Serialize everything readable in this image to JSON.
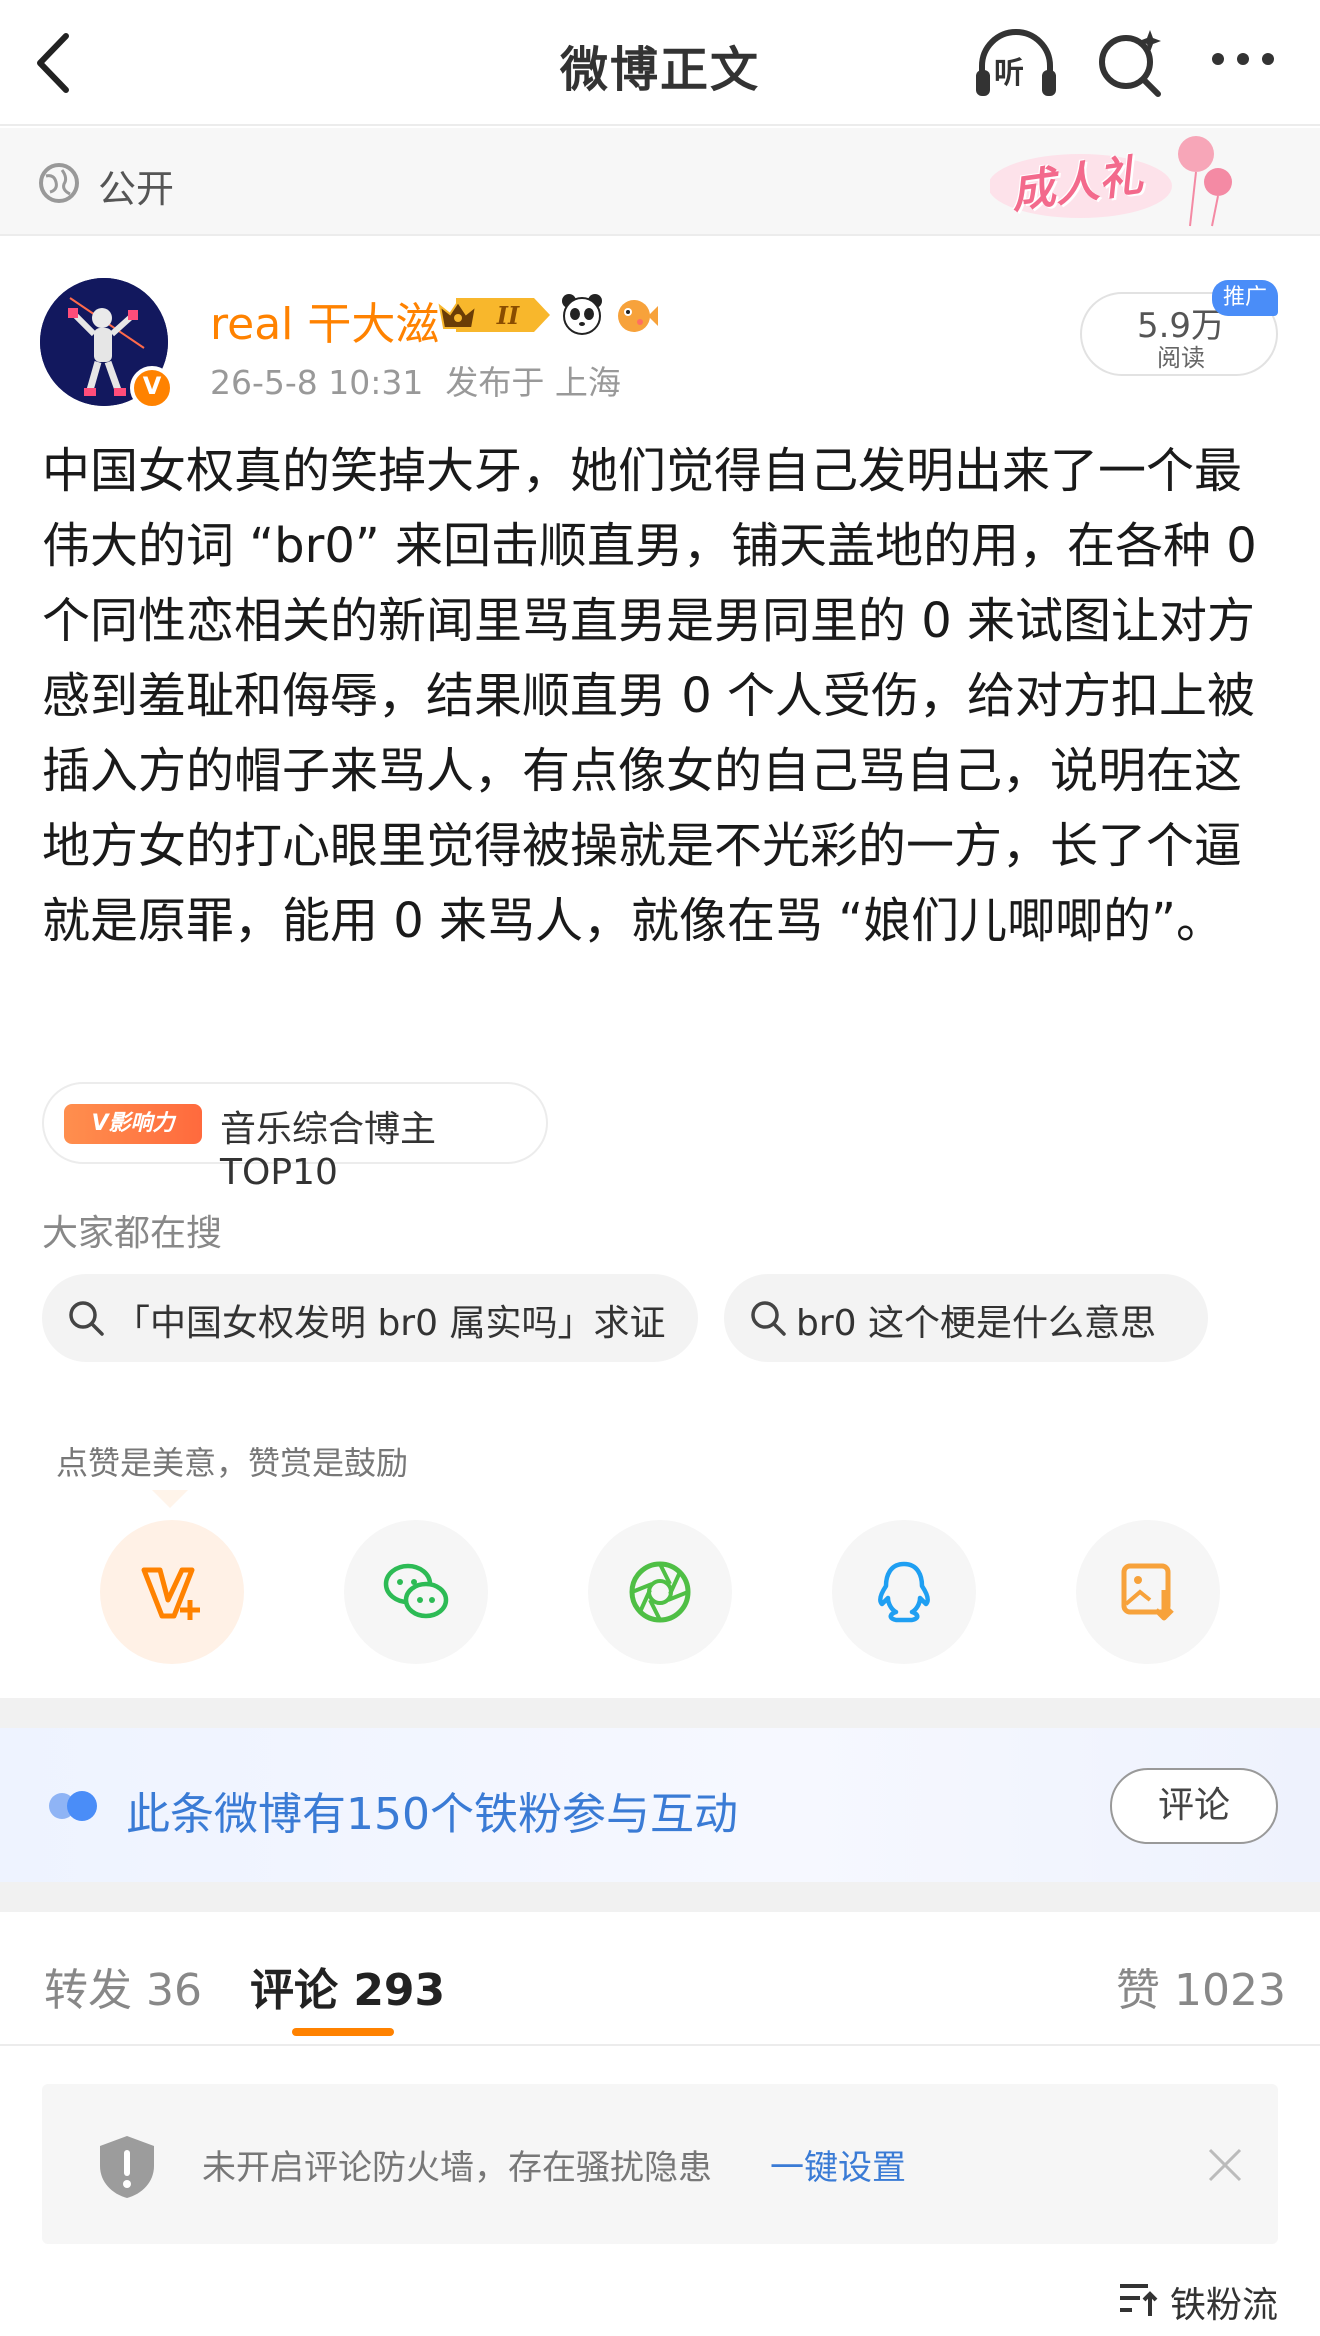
{
  "nav": {
    "title": "微博正文",
    "listen_label": "听"
  },
  "visibility": {
    "label": "公开",
    "banner": "成人礼"
  },
  "author": {
    "name": "real 干大滋",
    "level_badge": "II",
    "verified_mark": "V",
    "time": "26-5-8 10:31",
    "location": "发布于 上海"
  },
  "reads": {
    "count": "5.9万",
    "label": "阅读",
    "promo_tag": "推广"
  },
  "post": {
    "text": "中国女权真的笑掉大牙，她们觉得自己发明出来了一个最伟大的词 “br0” 来回击顺直男，铺天盖地的用，在各种 0 个同性恋相关的新闻里骂直男是男同里的 0 来试图让对方感到羞耻和侮辱，结果顺直男 0 个人受伤，给对方扣上被插入方的帽子来骂人，有点像女的自己骂自己，说明在这地方女的打心眼里觉得被操就是不光彩的一方，长了个逼就是原罪，能用 0 来骂人，就像在骂 “娘们儿唧唧的”。"
  },
  "influence": {
    "badge": "V影响力",
    "label": "音乐综合博主TOP10"
  },
  "search": {
    "title": "大家都在搜",
    "chips": [
      "「中国女权发明 br0 属实吗」求证",
      "br0 这个梗是什么意思"
    ]
  },
  "share": {
    "tip": "点赞是美意，赞赏是鼓励",
    "buttons": [
      "reward-icon",
      "wechat-icon",
      "moments-icon",
      "qq-icon",
      "save-image-icon"
    ]
  },
  "fans": {
    "text": "此条微博有150个铁粉参与互动",
    "button": "评论"
  },
  "tabs": {
    "repost": "转发 36",
    "comments": "评论 293",
    "likes": "赞 1023"
  },
  "firewall": {
    "text": "未开启评论防火墙，存在骚扰隐患",
    "link": "一键设置"
  },
  "sort": {
    "label": "铁粉流"
  },
  "colors": {
    "brand_orange": "#ff8200",
    "link_blue": "#3a7bd5",
    "promo_blue": "#4a8df8",
    "avatar_navy": "#12185e"
  }
}
